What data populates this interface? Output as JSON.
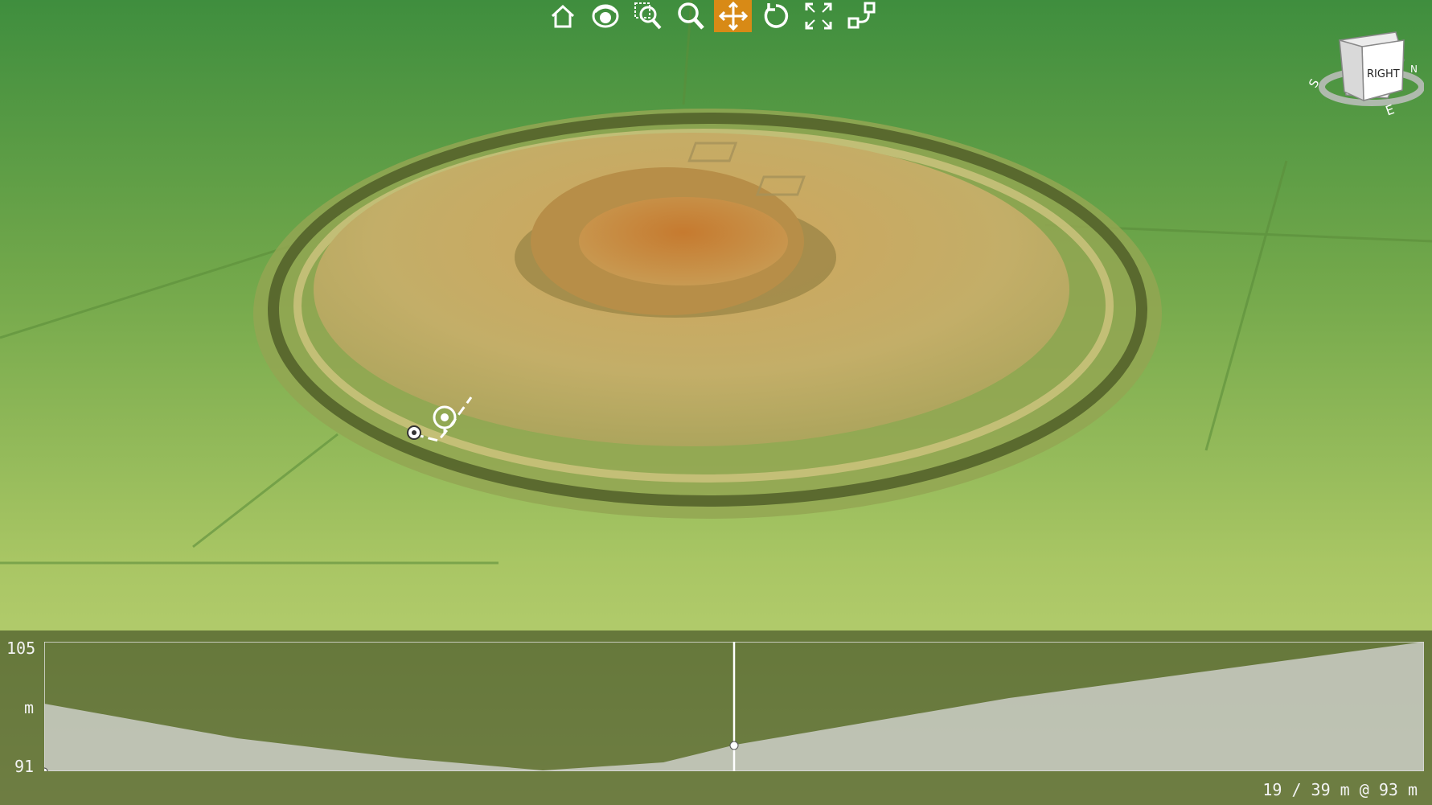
{
  "toolbar": {
    "tools": [
      {
        "icon": "home-icon",
        "label": "Home"
      },
      {
        "icon": "eye-icon",
        "label": "Look"
      },
      {
        "icon": "zoom-window-icon",
        "label": "Zoom window"
      },
      {
        "icon": "zoom-icon",
        "label": "Zoom"
      },
      {
        "icon": "pan-icon",
        "label": "Pan",
        "active": true
      },
      {
        "icon": "rotate-icon",
        "label": "Rotate"
      },
      {
        "icon": "fullscreen-icon",
        "label": "Fit"
      },
      {
        "icon": "profile-tool-icon",
        "label": "Profile"
      }
    ],
    "active_color": "#d88a16"
  },
  "viewcube": {
    "face_label": "RIGHT",
    "compass": [
      "S",
      "E",
      "N"
    ]
  },
  "profile": {
    "y_max_label": "105",
    "y_unit_label": "m",
    "y_min_label": "91",
    "status_text": "19 / 39 m @ 93 m",
    "cursor_fraction": 0.5,
    "elevation_range": [
      91,
      105
    ]
  },
  "colors": {
    "terrain_low": "#4f9a3a",
    "terrain_mid": "#b9cf72",
    "terrain_high": "#c98a3a",
    "profile_fill": "#d9d9d9"
  }
}
